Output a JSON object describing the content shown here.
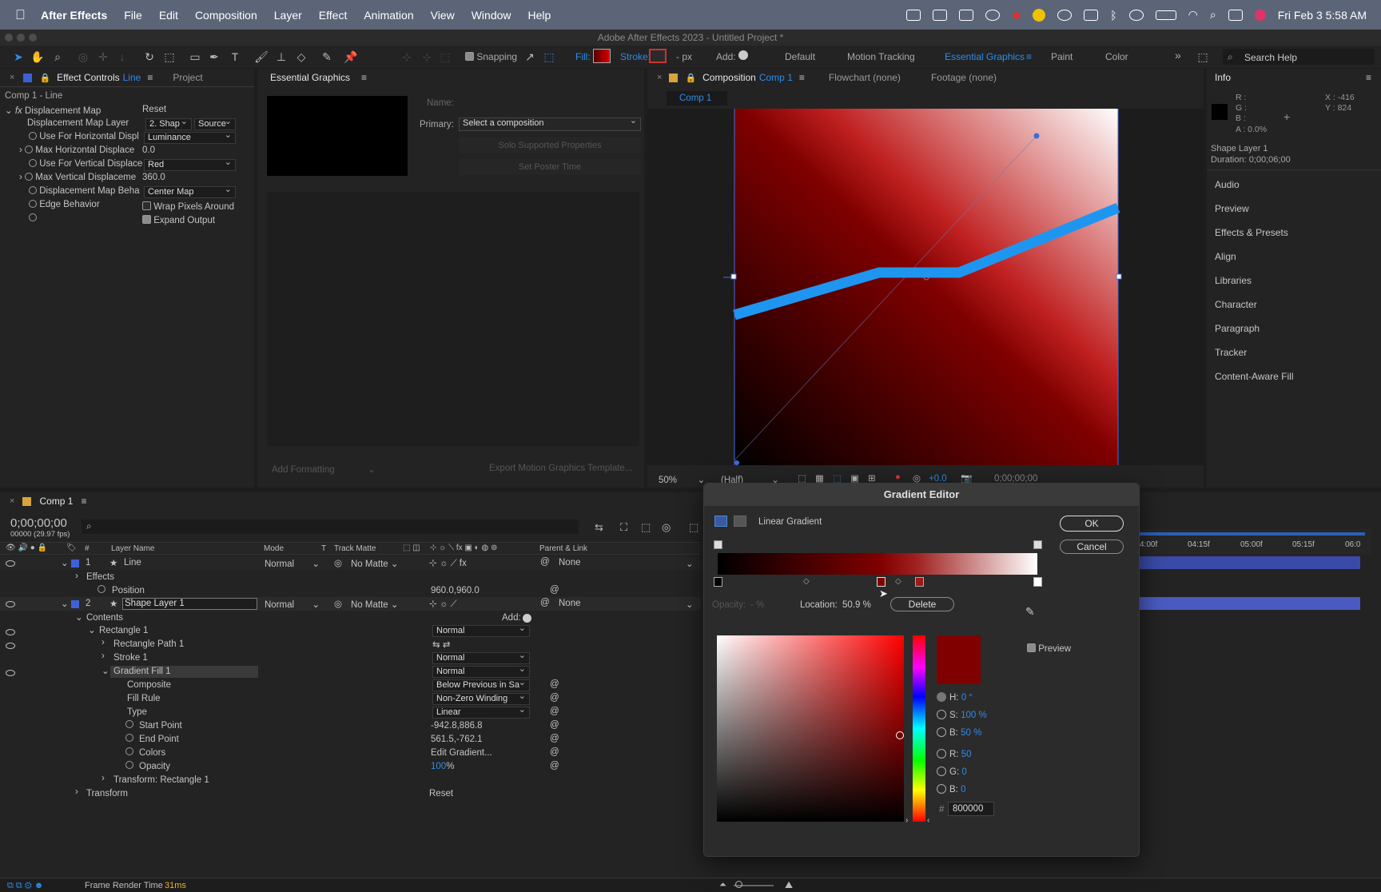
{
  "menubar": {
    "app": "After Effects",
    "items": [
      "File",
      "Edit",
      "Composition",
      "Layer",
      "Effect",
      "Animation",
      "View",
      "Window",
      "Help"
    ],
    "datetime": "Fri Feb 3  5:58 AM"
  },
  "window_title": "Adobe After Effects 2023 - Untitled Project *",
  "toolbar": {
    "snapping": "Snapping",
    "fill": "Fill:",
    "stroke": "Stroke:",
    "px": "- px",
    "add": "Add:",
    "workspaces": [
      "Default",
      "Motion Tracking",
      "Essential Graphics",
      "Paint",
      "Color"
    ],
    "search": "Search Help"
  },
  "effect_controls": {
    "tab": "Effect Controls",
    "tab_layer": "Line",
    "tab2": "Project",
    "subtitle": "Comp 1 - Line",
    "effect": "Displacement Map",
    "reset": "Reset",
    "props": [
      {
        "label": "Displacement Map Layer",
        "val": "2. Shap",
        "val2": "Source"
      },
      {
        "label": "Use For Horizontal Displ",
        "val": "Luminance"
      },
      {
        "label": "Max Horizontal Displace",
        "val": "0.0"
      },
      {
        "label": "Use For Vertical Displace",
        "val": "Red"
      },
      {
        "label": "Max Vertical Displaceme",
        "val": "360.0"
      },
      {
        "label": "Displacement Map Beha",
        "val": "Center Map"
      },
      {
        "label": "Edge Behavior",
        "val": "Wrap Pixels Around"
      },
      {
        "label": "",
        "val": "Expand Output"
      }
    ]
  },
  "essential_graphics": {
    "tab": "Essential Graphics",
    "name_label": "Name:",
    "primary_label": "Primary:",
    "primary_value": "Select a composition",
    "solo": "Solo Supported Properties",
    "poster": "Set Poster Time",
    "add_formatting": "Add Formatting",
    "export": "Export Motion Graphics Template..."
  },
  "composition": {
    "tab": "Composition",
    "tab_comp": "Comp 1",
    "flowchart": "Flowchart (none)",
    "footage": "Footage (none)",
    "crumb": "Comp 1",
    "zoom": "50%",
    "res": "(Half)",
    "exposure": "+0.0",
    "time": "0;00;00;00"
  },
  "info": {
    "tab": "Info",
    "r": "R :",
    "g": "G :",
    "b": "B :",
    "a": "A :  0.0%",
    "x": "X : -416",
    "y": "Y :  824",
    "layer": "Shape Layer 1",
    "duration": "Duration: 0;00;06;00",
    "panels": [
      "Audio",
      "Preview",
      "Effects & Presets",
      "Align",
      "Libraries",
      "Character",
      "Paragraph",
      "Tracker",
      "Content-Aware Fill"
    ]
  },
  "timeline": {
    "tab": "Comp 1",
    "timecode": "0;00;00;00",
    "fps": "00000 (29.97 fps)",
    "cols": {
      "num": "#",
      "layer": "Layer Name",
      "mode": "Mode",
      "t": "T",
      "matte": "Track Matte",
      "parent": "Parent & Link"
    },
    "ruler": [
      "4:00f",
      "04:15f",
      "05:00f",
      "05:15f",
      "06:0"
    ],
    "layer1": {
      "num": "1",
      "name": "Line",
      "mode": "Normal",
      "matte": "No Matte",
      "parent": "None"
    },
    "effects": "Effects",
    "position": "Position",
    "position_val": "960.0,960.0",
    "layer2": {
      "num": "2",
      "name": "Shape Layer 1",
      "mode": "Normal",
      "matte": "No Matte",
      "parent": "None"
    },
    "contents": "Contents",
    "add": "Add:",
    "rect1": "Rectangle 1",
    "rect1_mode": "Normal",
    "rect_path": "Rectangle Path 1",
    "stroke1": "Stroke 1",
    "stroke1_mode": "Normal",
    "gfill": "Gradient Fill 1",
    "gfill_mode": "Normal",
    "props": [
      {
        "label": "Composite",
        "val": "Below Previous in Sa"
      },
      {
        "label": "Fill Rule",
        "val": "Non-Zero Winding"
      },
      {
        "label": "Type",
        "val": "Linear"
      }
    ],
    "start": "Start Point",
    "start_val": "-942.8,886.8",
    "end": "End Point",
    "end_val": "561.5,-762.1",
    "colors": "Colors",
    "colors_val": "Edit Gradient...",
    "opacity": "Opacity",
    "opacity_val": "100",
    "opacity_unit": "%",
    "transform_rect": "Transform: Rectangle 1",
    "transform": "Transform",
    "transform_reset": "Reset",
    "frame_render": "Frame Render Time",
    "frame_ms": "31ms"
  },
  "gradient_editor": {
    "title": "Gradient Editor",
    "type": "Linear Gradient",
    "ok": "OK",
    "cancel": "Cancel",
    "opacity_label": "Opacity:",
    "opacity_val": "- %",
    "location_label": "Location:",
    "location_val": "50.9 %",
    "delete": "Delete",
    "preview": "Preview",
    "h": "H:",
    "h_val": "0 °",
    "s": "S:",
    "s_val": "100 %",
    "bb": "B:",
    "bb_val": "50 %",
    "r": "R:",
    "r_val": "50",
    "g": "G:",
    "g_val": "0",
    "b": "B:",
    "b_val": "0",
    "hash": "#",
    "hex": "800000",
    "colors": {
      "dark": "#000000",
      "mid": "#800000",
      "light": "#ffffff"
    }
  },
  "colors": {
    "accent": "#2d8ceb",
    "line_blue": "#1e96f0",
    "panel": "#232323"
  }
}
